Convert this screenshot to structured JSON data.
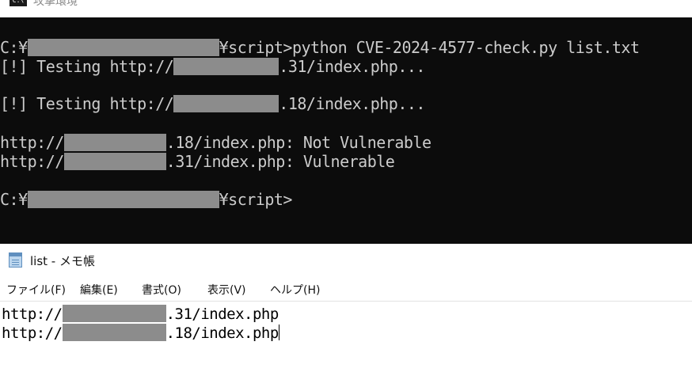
{
  "console": {
    "title": "攻撃環境",
    "icon_label": "C:\\",
    "lines": [
      {
        "prefix": "C:¥",
        "suffix": "¥script>python CVE-2024-4577-check.py list.txt"
      },
      {
        "prefix": "[!] Testing http://",
        "suffix": ".31/index.php..."
      },
      {
        "prefix": "[!] Testing http://",
        "suffix": ".18/index.php..."
      },
      {
        "prefix": "http://",
        "suffix": ".18/index.php: Not Vulnerable"
      },
      {
        "prefix": "http://",
        "suffix": ".31/index.php: Vulnerable"
      },
      {
        "prefix": "C:¥",
        "suffix": "¥script>"
      }
    ]
  },
  "notepad": {
    "title": "list - メモ帳",
    "menu": [
      "ファイル(F)",
      "編集(E)",
      "書式(O)",
      "表示(V)",
      "ヘルプ(H)"
    ],
    "lines": [
      {
        "prefix": "http://",
        "suffix": ".31/index.php"
      },
      {
        "prefix": "http://",
        "suffix": ".18/index.php"
      }
    ]
  }
}
